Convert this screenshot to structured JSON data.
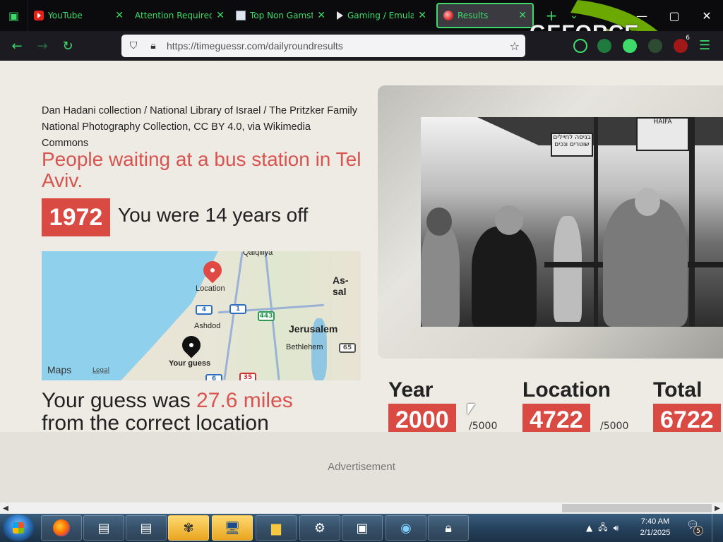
{
  "browser": {
    "tabs": [
      {
        "label": "YouTube",
        "icon": "youtube-icon"
      },
      {
        "label": "Attention Required! | C",
        "icon": "document-icon"
      },
      {
        "label": "Top Non Gamstop",
        "icon": "document-icon"
      },
      {
        "label": "Gaming / Emulati",
        "icon": "play-icon"
      },
      {
        "label": "Results",
        "icon": "globe-icon",
        "active": true
      }
    ],
    "new_tab": "+",
    "tab_list": "⌄",
    "overlay_brand": "GEFORCE",
    "extension_badge": "6",
    "url": "https://timeguessr.com/dailyroundresults",
    "accent": "#3ddc6a"
  },
  "page": {
    "credit": "Dan Hadani collection / National Library of Israel / The Pritzker Family National Photography Collection, CC BY 4.0, via Wikimedia Commons",
    "caption": "People waiting at a bus station in Tel Aviv.",
    "correct_year": "1972",
    "years_off": "You were 14 years off",
    "map": {
      "labels": {
        "qalqiliya": "Qalqiliya",
        "as_sal": "As-sal",
        "location": "Location",
        "ashdod": "Ashdod",
        "jerusalem": "Jerusalem",
        "bethlehem": "Bethlehem",
        "your_guess": "Your guess",
        "shield_1": "1",
        "shield_4": "4",
        "shield_443": "443",
        "shield_65": "65",
        "shield_35": "35",
        "shield_6": "6",
        "logo": "Maps",
        "legal": "Legal"
      }
    },
    "distance_prefix": "Your guess was ",
    "distance_value": "27.6 miles",
    "distance_suffix": "from the correct location",
    "photo_signs": {
      "top": "HAIFA",
      "hebrew1": "בניסה לחיילים",
      "hebrew2": "שוטרים ונכים"
    },
    "scores": {
      "year_label": "Year",
      "year_value": "2000",
      "year_max": "/5000",
      "location_label": "Location",
      "location_value": "4722",
      "location_max": "/5000",
      "total_label": "Total",
      "total_value": "6722"
    },
    "advertisement": "Advertisement"
  },
  "taskbar": {
    "time": "7:40 AM",
    "date": "2/1/2025",
    "notification_count": "5"
  }
}
